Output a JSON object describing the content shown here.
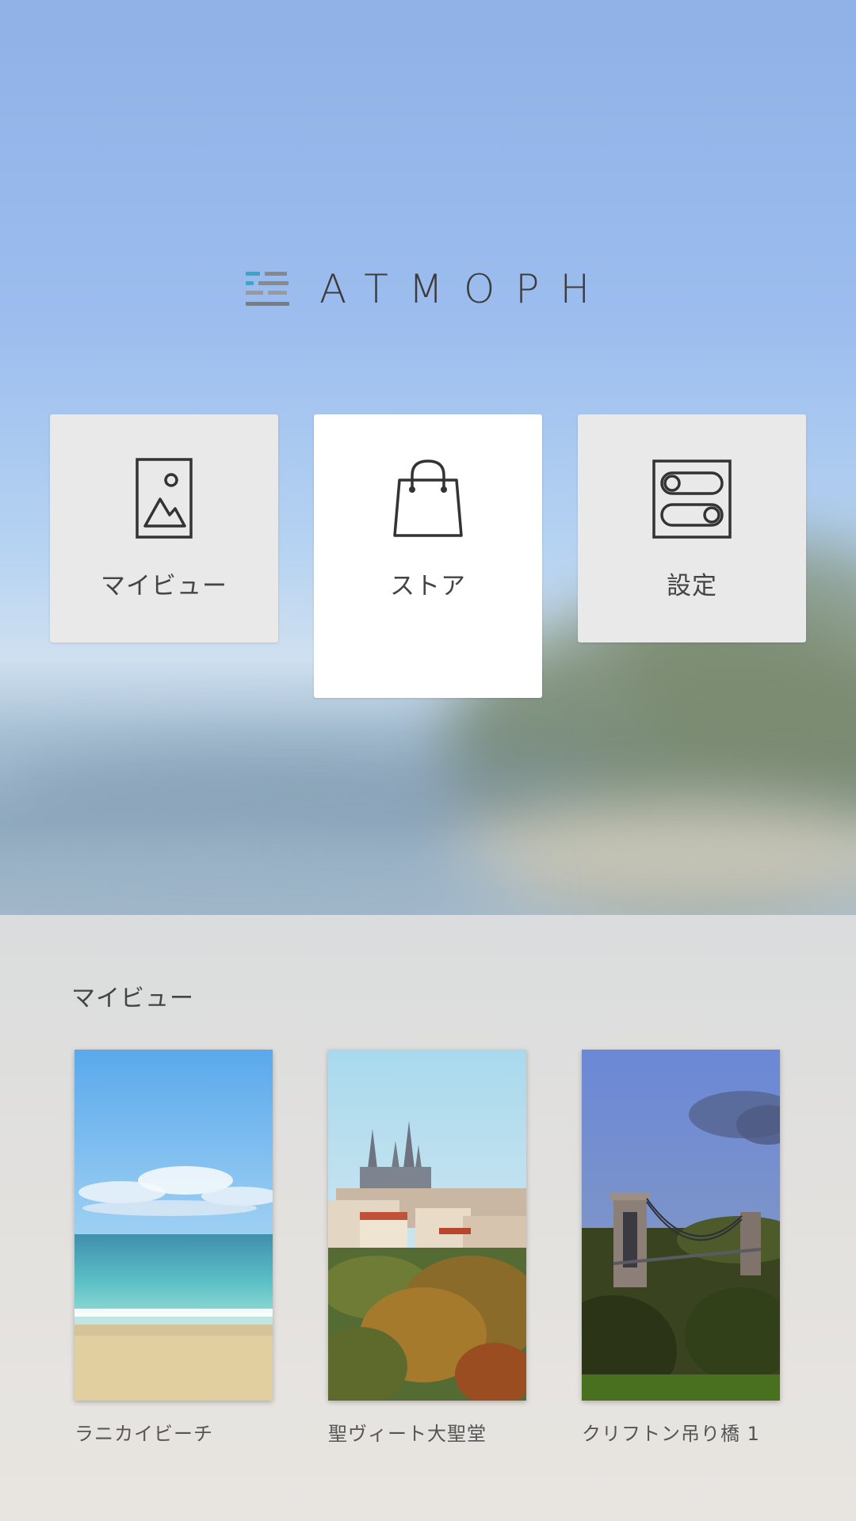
{
  "brand": {
    "name": "ATMOPH"
  },
  "menu": {
    "items": [
      {
        "label": "マイビュー",
        "icon": "image-frame-icon"
      },
      {
        "label": "ストア",
        "icon": "shopping-bag-icon",
        "selected": true
      },
      {
        "label": "設定",
        "icon": "toggle-settings-icon"
      }
    ]
  },
  "myview": {
    "title": "マイビュー",
    "items": [
      {
        "caption": "ラニカイビーチ",
        "image": "beach-landscape"
      },
      {
        "caption": "聖ヴィート大聖堂",
        "image": "cathedral-landscape"
      },
      {
        "caption": "クリフトン吊り橋 1",
        "image": "bridge-landscape"
      }
    ]
  },
  "colors": {
    "accent": "#3aa6c8",
    "logo_text": "#3c3c3c",
    "tile_bg": "#e9e9e9",
    "tile_active_bg": "#ffffff"
  }
}
